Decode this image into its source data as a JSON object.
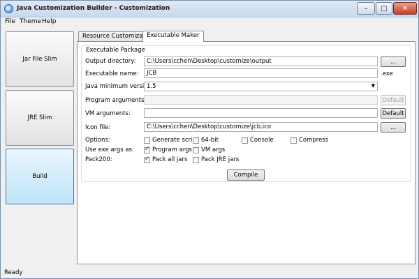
{
  "window": {
    "title": "Java Customization Builder - Customization"
  },
  "controls": {
    "minimize": "–",
    "maximize": "□",
    "close": "✕"
  },
  "menu": [
    "File",
    "Theme",
    "Help"
  ],
  "nav": [
    "Jar File Slim",
    "JRE Slim",
    "Build"
  ],
  "tabs": [
    "Resource Customization",
    "Executable Maker"
  ],
  "group_title": "Executable Package",
  "fields": {
    "output_dir": {
      "label": "Output directory:",
      "value": "C:\\Users\\cchen\\Desktop\\customize\\output",
      "button": "..."
    },
    "exe_name": {
      "label": "Executable name:",
      "value": "JCB",
      "ext": ".exe"
    },
    "java_min": {
      "label": "Java minimum version:",
      "value": "1.5"
    },
    "program_args": {
      "label": "Program arguments:",
      "value": "",
      "button": "Default"
    },
    "vm_args": {
      "label": "VM arguments:",
      "value": "",
      "button": "Default"
    },
    "icon_file": {
      "label": "Icon file:",
      "value": "C:\\Users\\cchen\\Desktop\\customize\\jcb.ico",
      "button": "..."
    }
  },
  "options": {
    "label": "Options:",
    "items": [
      {
        "label": "Generate script",
        "checked": false
      },
      {
        "label": "64-bit",
        "checked": false
      },
      {
        "label": "Console",
        "checked": false
      },
      {
        "label": "Compress",
        "checked": false
      }
    ]
  },
  "exe_args": {
    "label": "Use exe args as:",
    "items": [
      {
        "label": "Program args",
        "checked": true
      },
      {
        "label": "VM args",
        "checked": false
      }
    ]
  },
  "pack200": {
    "label": "Pack200:",
    "items": [
      {
        "label": "Pack all jars",
        "checked": true
      },
      {
        "label": "Pack JRE jars",
        "checked": false
      }
    ]
  },
  "compile_button": "Compile",
  "status": "Ready"
}
